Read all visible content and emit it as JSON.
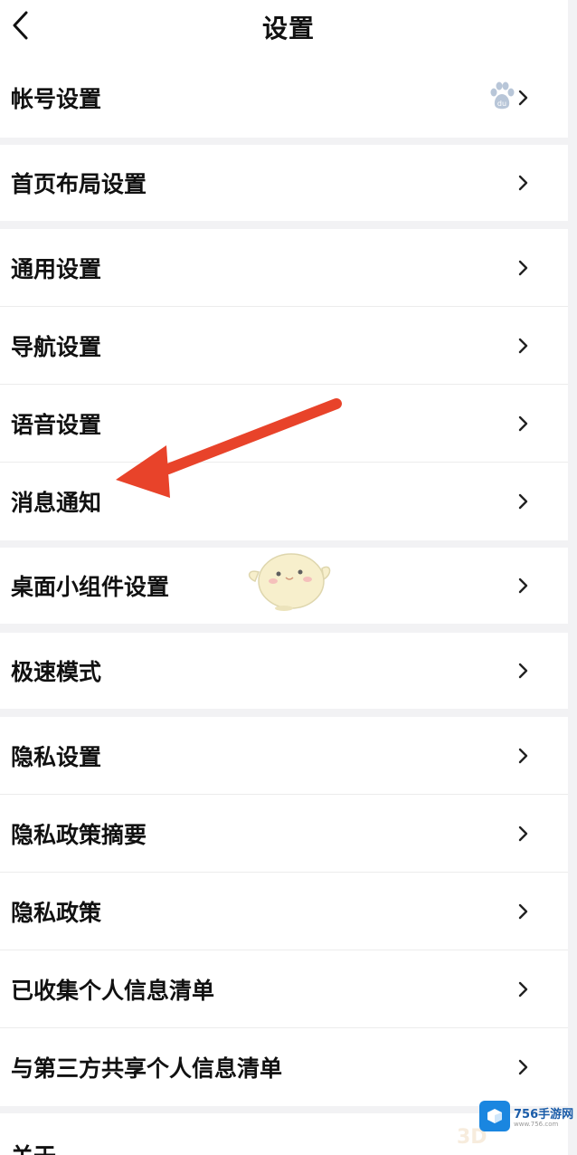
{
  "header": {
    "title": "设置"
  },
  "rows": [
    {
      "label": "帐号设置"
    },
    {
      "label": "首页布局设置"
    },
    {
      "label": "通用设置"
    },
    {
      "label": "导航设置"
    },
    {
      "label": "语音设置"
    },
    {
      "label": "消息通知"
    },
    {
      "label": "桌面小组件设置"
    },
    {
      "label": "极速模式"
    },
    {
      "label": "隐私设置"
    },
    {
      "label": "隐私政策摘要"
    },
    {
      "label": "隐私政策"
    },
    {
      "label": "已收集个人信息清单"
    },
    {
      "label": "与第三方共享个人信息清单"
    },
    {
      "label": "关于"
    }
  ],
  "watermark": {
    "brand": "756手游网",
    "url": "www.756.com",
    "faint": "3D"
  },
  "colors": {
    "arrow": "#e8432a",
    "paw": "#b8c6d8",
    "watermark": "#1a86e0"
  },
  "icons": {
    "back": "back-arrow-icon",
    "chevron": "chevron-right-icon",
    "paw": "baidu-paw-icon",
    "mascot": "bird-mascot-sticker"
  }
}
